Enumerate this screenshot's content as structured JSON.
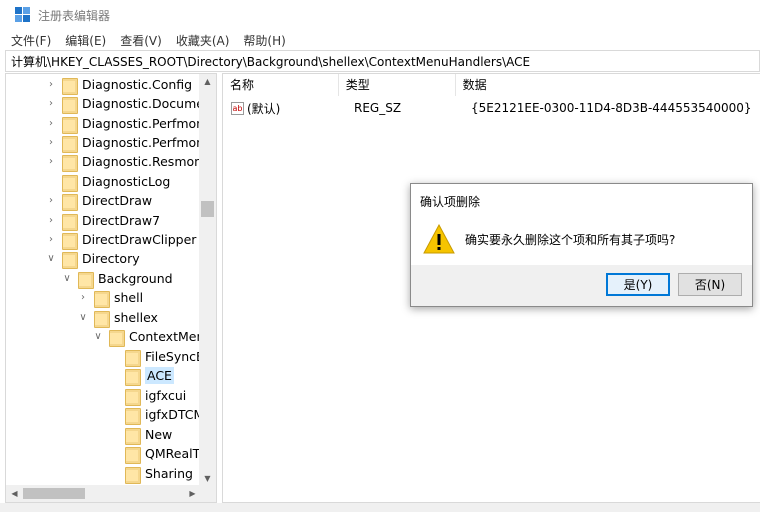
{
  "window": {
    "title": "注册表编辑器",
    "app_icon": "registry-editor-icon"
  },
  "menu": [
    "文件(F)",
    "编辑(E)",
    "查看(V)",
    "收藏夹(A)",
    "帮助(H)"
  ],
  "address": "计算机\\HKEY_CLASSES_ROOT\\Directory\\Background\\shellex\\ContextMenuHandlers\\ACE",
  "tree": {
    "items": [
      {
        "label": "Diagnostic.Config",
        "expander": "collapsed"
      },
      {
        "label": "Diagnostic.Document",
        "expander": "collapsed"
      },
      {
        "label": "Diagnostic.Perfmon.C",
        "expander": "collapsed"
      },
      {
        "label": "Diagnostic.Perfmon.D",
        "expander": "collapsed"
      },
      {
        "label": "Diagnostic.Resmon.C",
        "expander": "collapsed"
      },
      {
        "label": "DiagnosticLog",
        "expander": "none"
      },
      {
        "label": "DirectDraw",
        "expander": "collapsed"
      },
      {
        "label": "DirectDraw7",
        "expander": "collapsed"
      },
      {
        "label": "DirectDrawClipper",
        "expander": "collapsed"
      },
      {
        "label": "Directory",
        "expander": "expanded"
      },
      {
        "label": "Background",
        "expander": "expanded"
      },
      {
        "label": "shell",
        "expander": "collapsed"
      },
      {
        "label": "shellex",
        "expander": "expanded"
      },
      {
        "label": "ContextMenu",
        "expander": "expanded"
      },
      {
        "label": "FileSyncEx",
        "expander": "none"
      },
      {
        "label": "ACE",
        "expander": "none",
        "selected": true
      },
      {
        "label": "igfxcui",
        "expander": "none"
      },
      {
        "label": "igfxDTCM",
        "expander": "none"
      },
      {
        "label": "New",
        "expander": "none"
      },
      {
        "label": "QMRealTi",
        "expander": "none"
      },
      {
        "label": "Sharing",
        "expander": "none"
      }
    ]
  },
  "list": {
    "columns": [
      "名称",
      "类型",
      "数据"
    ],
    "rows": [
      {
        "name": "(默认)",
        "type": "REG_SZ",
        "data": "{5E2121EE-0300-11D4-8D3B-444553540000}",
        "icon": "string-value-icon",
        "icon_text": "ab"
      }
    ]
  },
  "dialog": {
    "title": "确认项删除",
    "message": "确实要永久删除这个项和所有其子项吗?",
    "icon": "warning-icon",
    "yes_label": "是(Y)",
    "no_label": "否(N)"
  },
  "colors": {
    "accent": "#0078d7",
    "selection": "#cce8ff",
    "folder": "#f5d78e",
    "warning": "#f6c400"
  }
}
